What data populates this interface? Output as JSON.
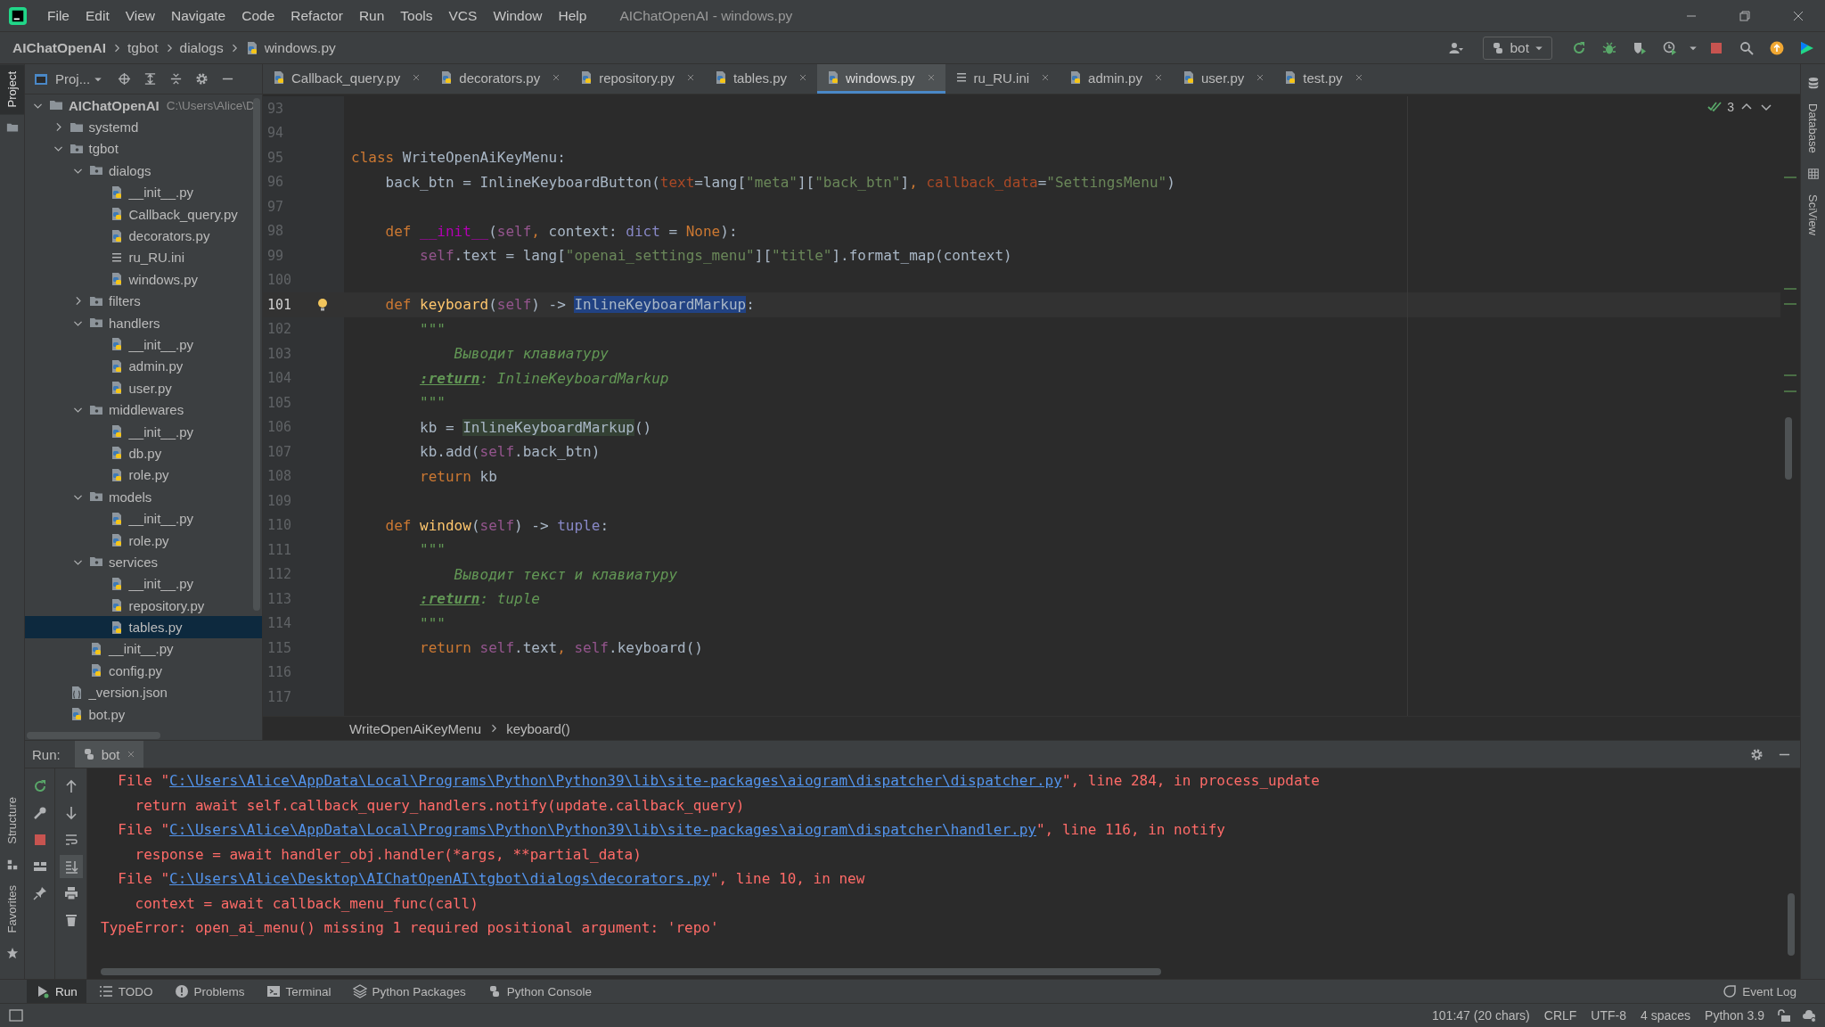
{
  "window": {
    "title": "AIChatOpenAI - windows.py"
  },
  "menu": [
    "File",
    "Edit",
    "View",
    "Navigate",
    "Code",
    "Refactor",
    "Run",
    "Tools",
    "VCS",
    "Window",
    "Help"
  ],
  "breadcrumbs": [
    "AIChatOpenAI",
    "tgbot",
    "dialogs",
    "windows.py"
  ],
  "run_config": "bot",
  "left_strip_top": [
    {
      "label": "Project",
      "selected": true
    }
  ],
  "left_strip_bottom": [
    {
      "label": "Structure",
      "selected": false
    },
    {
      "label": "Favorites",
      "selected": false
    }
  ],
  "right_strip": [
    "Database",
    "SciView"
  ],
  "project": {
    "view": "Proj...",
    "tree": [
      {
        "label": "AIChatOpenAI",
        "hint": "C:\\Users\\Alice\\D",
        "kind": "folder",
        "expanded": true,
        "selected": false,
        "children": [
          {
            "label": "systemd",
            "kind": "folder",
            "expanded": false,
            "selected": false
          },
          {
            "label": "tgbot",
            "kind": "package",
            "expanded": true,
            "selected": false,
            "children": [
              {
                "label": "dialogs",
                "kind": "package",
                "expanded": true,
                "selected": false,
                "children": [
                  {
                    "label": "__init__.py",
                    "kind": "py",
                    "selected": false
                  },
                  {
                    "label": "Callback_query.py",
                    "kind": "py",
                    "selected": false
                  },
                  {
                    "label": "decorators.py",
                    "kind": "py",
                    "selected": false
                  },
                  {
                    "label": "ru_RU.ini",
                    "kind": "ini",
                    "selected": false
                  },
                  {
                    "label": "windows.py",
                    "kind": "py",
                    "selected": false
                  }
                ]
              },
              {
                "label": "filters",
                "kind": "package",
                "expanded": false,
                "selected": false
              },
              {
                "label": "handlers",
                "kind": "package",
                "expanded": true,
                "selected": false,
                "children": [
                  {
                    "label": "__init__.py",
                    "kind": "py",
                    "selected": false
                  },
                  {
                    "label": "admin.py",
                    "kind": "py",
                    "selected": false
                  },
                  {
                    "label": "user.py",
                    "kind": "py",
                    "selected": false
                  }
                ]
              },
              {
                "label": "middlewares",
                "kind": "package",
                "expanded": true,
                "selected": false,
                "children": [
                  {
                    "label": "__init__.py",
                    "kind": "py",
                    "selected": false
                  },
                  {
                    "label": "db.py",
                    "kind": "py",
                    "selected": false
                  },
                  {
                    "label": "role.py",
                    "kind": "py",
                    "selected": false
                  }
                ]
              },
              {
                "label": "models",
                "kind": "package",
                "expanded": true,
                "selected": false,
                "children": [
                  {
                    "label": "__init__.py",
                    "kind": "py",
                    "selected": false
                  },
                  {
                    "label": "role.py",
                    "kind": "py",
                    "selected": false
                  }
                ]
              },
              {
                "label": "services",
                "kind": "package",
                "expanded": true,
                "selected": false,
                "children": [
                  {
                    "label": "__init__.py",
                    "kind": "py",
                    "selected": false
                  },
                  {
                    "label": "repository.py",
                    "kind": "py",
                    "selected": false
                  },
                  {
                    "label": "tables.py",
                    "kind": "py",
                    "selected": true
                  }
                ]
              },
              {
                "label": "__init__.py",
                "kind": "py",
                "selected": false
              },
              {
                "label": "config.py",
                "kind": "py",
                "selected": false
              }
            ]
          },
          {
            "label": "_version.json",
            "kind": "json",
            "selected": false
          },
          {
            "label": "bot.py",
            "kind": "py",
            "selected": false
          }
        ]
      }
    ]
  },
  "editor": {
    "tabs": [
      {
        "label": "Callback_query.py",
        "kind": "py",
        "selected": false
      },
      {
        "label": "decorators.py",
        "kind": "py",
        "selected": false
      },
      {
        "label": "repository.py",
        "kind": "py",
        "selected": false
      },
      {
        "label": "tables.py",
        "kind": "py",
        "selected": false
      },
      {
        "label": "windows.py",
        "kind": "py",
        "selected": true
      },
      {
        "label": "ru_RU.ini",
        "kind": "ini",
        "selected": false
      },
      {
        "label": "admin.py",
        "kind": "py",
        "selected": false
      },
      {
        "label": "user.py",
        "kind": "py",
        "selected": false
      },
      {
        "label": "test.py",
        "kind": "py",
        "selected": false
      }
    ],
    "inspection_count": "3",
    "lines": [
      {
        "n": "93",
        "current": false
      },
      {
        "n": "94",
        "current": false
      },
      {
        "n": "95",
        "current": false,
        "tokens": [
          {
            "text": "class",
            "kind": "kw"
          },
          {
            "text": " WriteOpenAiKeyMenu:",
            "kind": "plain"
          }
        ]
      },
      {
        "n": "96",
        "current": false,
        "tokens": [
          {
            "text": "    back_btn = InlineKeyboardButton(",
            "kind": "plain"
          },
          {
            "text": "text",
            "kind": "kwarg"
          },
          {
            "text": "=lang[",
            "kind": "plain"
          },
          {
            "text": "\"meta\"",
            "kind": "str"
          },
          {
            "text": "][",
            "kind": "plain"
          },
          {
            "text": "\"back_btn\"",
            "kind": "str"
          },
          {
            "text": "]",
            "kind": "plain"
          },
          {
            "text": ", ",
            "kind": "kw"
          },
          {
            "text": "callback_data",
            "kind": "kwarg"
          },
          {
            "text": "=",
            "kind": "plain"
          },
          {
            "text": "\"SettingsMenu\"",
            "kind": "str"
          },
          {
            "text": ")",
            "kind": "plain"
          }
        ]
      },
      {
        "n": "97",
        "current": false
      },
      {
        "n": "98",
        "current": false,
        "tokens": [
          {
            "text": "    def",
            "kind": "kw"
          },
          {
            "text": " __init__",
            "kind": "magic"
          },
          {
            "text": "(",
            "kind": "plain"
          },
          {
            "text": "self",
            "kind": "self"
          },
          {
            "text": ", ",
            "kind": "kw"
          },
          {
            "text": "context: ",
            "kind": "plain"
          },
          {
            "text": "dict",
            "kind": "builtin"
          },
          {
            "text": " = ",
            "kind": "plain"
          },
          {
            "text": "None",
            "kind": "kw"
          },
          {
            "text": "):",
            "kind": "plain"
          }
        ]
      },
      {
        "n": "99",
        "current": false,
        "tokens": [
          {
            "text": "        self",
            "kind": "self"
          },
          {
            "text": ".text = lang[",
            "kind": "plain"
          },
          {
            "text": "\"openai_settings_menu\"",
            "kind": "str"
          },
          {
            "text": "][",
            "kind": "plain"
          },
          {
            "text": "\"title\"",
            "kind": "str"
          },
          {
            "text": "].format_map(context)",
            "kind": "plain"
          }
        ]
      },
      {
        "n": "100",
        "current": false
      },
      {
        "n": "101",
        "current": true,
        "bulb": true,
        "tokens": [
          {
            "text": "    def",
            "kind": "kw"
          },
          {
            "text": " keyboard",
            "kind": "fn"
          },
          {
            "text": "(",
            "kind": "plain"
          },
          {
            "text": "self",
            "kind": "self"
          },
          {
            "text": ") -> ",
            "kind": "plain"
          },
          {
            "text": "InlineKeyboardMarkup",
            "kind": "sel"
          },
          {
            "text": ":",
            "kind": "plain"
          }
        ]
      },
      {
        "n": "102",
        "current": false,
        "tokens": [
          {
            "text": "        \"\"\"",
            "kind": "doc"
          }
        ]
      },
      {
        "n": "103",
        "current": false,
        "tokens": [
          {
            "text": "            Выводит клавиатуру",
            "kind": "doc"
          }
        ]
      },
      {
        "n": "104",
        "current": false,
        "tokens": [
          {
            "text": "        :return",
            "kind": "docref"
          },
          {
            "text": ": InlineKeyboardMarkup",
            "kind": "doc"
          }
        ]
      },
      {
        "n": "105",
        "current": false,
        "tokens": [
          {
            "text": "        \"\"\"",
            "kind": "doc"
          }
        ]
      },
      {
        "n": "106",
        "current": false,
        "tokens": [
          {
            "text": "        kb = ",
            "kind": "plain"
          },
          {
            "text": "InlineKeyboardMarkup",
            "kind": "hl"
          },
          {
            "text": "()",
            "kind": "plain"
          }
        ]
      },
      {
        "n": "107",
        "current": false,
        "tokens": [
          {
            "text": "        kb.add(",
            "kind": "plain"
          },
          {
            "text": "self",
            "kind": "self"
          },
          {
            "text": ".back_btn)",
            "kind": "plain"
          }
        ]
      },
      {
        "n": "108",
        "current": false,
        "tokens": [
          {
            "text": "        return",
            "kind": "kw"
          },
          {
            "text": " kb",
            "kind": "plain"
          }
        ]
      },
      {
        "n": "109",
        "current": false
      },
      {
        "n": "110",
        "current": false,
        "tokens": [
          {
            "text": "    def",
            "kind": "kw"
          },
          {
            "text": " window",
            "kind": "fn"
          },
          {
            "text": "(",
            "kind": "plain"
          },
          {
            "text": "self",
            "kind": "self"
          },
          {
            "text": ") -> ",
            "kind": "plain"
          },
          {
            "text": "tuple",
            "kind": "builtin"
          },
          {
            "text": ":",
            "kind": "plain"
          }
        ]
      },
      {
        "n": "111",
        "current": false,
        "tokens": [
          {
            "text": "        \"\"\"",
            "kind": "doc"
          }
        ]
      },
      {
        "n": "112",
        "current": false,
        "tokens": [
          {
            "text": "            Выводит текст и клавиатуру",
            "kind": "doc"
          }
        ]
      },
      {
        "n": "113",
        "current": false,
        "tokens": [
          {
            "text": "        :return",
            "kind": "docref"
          },
          {
            "text": ": tuple",
            "kind": "doc"
          }
        ]
      },
      {
        "n": "114",
        "current": false,
        "tokens": [
          {
            "text": "        \"\"\"",
            "kind": "doc"
          }
        ]
      },
      {
        "n": "115",
        "current": false,
        "tokens": [
          {
            "text": "        return",
            "kind": "kw"
          },
          {
            "text": " self",
            "kind": "self"
          },
          {
            "text": ".text",
            "kind": "plain"
          },
          {
            "text": ", ",
            "kind": "kw"
          },
          {
            "text": "self",
            "kind": "self"
          },
          {
            "text": ".keyboard()",
            "kind": "plain"
          }
        ]
      },
      {
        "n": "116",
        "current": false
      },
      {
        "n": "117",
        "current": false
      }
    ],
    "breadcrumbs": [
      "WriteOpenAiKeyMenu",
      "keyboard()"
    ]
  },
  "run": {
    "label": "Run:",
    "tab": "bot",
    "lines": [
      {
        "kind": "frame",
        "tokens": [
          {
            "text": "File \"",
            "kind": "err"
          },
          {
            "text": "C:\\Users\\Alice\\AppData\\Local\\Programs\\Python\\Python39\\lib\\site-packages\\aiogram\\dispatcher\\dispatcher.py",
            "kind": "link"
          },
          {
            "text": "\", line 284, in process_update",
            "kind": "err"
          }
        ]
      },
      {
        "kind": "source",
        "tokens": [
          {
            "text": "return await self.callback_query_handlers.notify(update.callback_query)",
            "kind": "err"
          }
        ]
      },
      {
        "kind": "frame",
        "tokens": [
          {
            "text": "File \"",
            "kind": "err"
          },
          {
            "text": "C:\\Users\\Alice\\AppData\\Local\\Programs\\Python\\Python39\\lib\\site-packages\\aiogram\\dispatcher\\handler.py",
            "kind": "link"
          },
          {
            "text": "\", line 116, in notify",
            "kind": "err"
          }
        ]
      },
      {
        "kind": "source",
        "tokens": [
          {
            "text": "response = await handler_obj.handler(*args, **partial_data)",
            "kind": "err"
          }
        ]
      },
      {
        "kind": "frame",
        "tokens": [
          {
            "text": "File \"",
            "kind": "err"
          },
          {
            "text": "C:\\Users\\Alice\\Desktop\\AIChatOpenAI\\tgbot\\dialogs\\decorators.py",
            "kind": "link"
          },
          {
            "text": "\", line 10, in new",
            "kind": "err"
          }
        ]
      },
      {
        "kind": "source",
        "tokens": [
          {
            "text": "context = await callback_menu_func(call)",
            "kind": "err"
          }
        ]
      },
      {
        "kind": "error",
        "tokens": [
          {
            "text": "TypeError: open_ai_menu() missing 1 required positional argument: 'repo'",
            "kind": "err"
          }
        ]
      }
    ]
  },
  "tool_windows": [
    {
      "label": "Run",
      "kind": "run",
      "selected": true
    },
    {
      "label": "TODO",
      "kind": "todo",
      "selected": false
    },
    {
      "label": "Problems",
      "kind": "problems",
      "selected": false
    },
    {
      "label": "Terminal",
      "kind": "terminal",
      "selected": false
    },
    {
      "label": "Python Packages",
      "kind": "packages",
      "selected": false
    },
    {
      "label": "Python Console",
      "kind": "console",
      "selected": false
    }
  ],
  "event_log": "Event Log",
  "status_bar": [
    "101:47 (20 chars)",
    "CRLF",
    "UTF-8",
    "4 spaces",
    "Python 3.9"
  ]
}
